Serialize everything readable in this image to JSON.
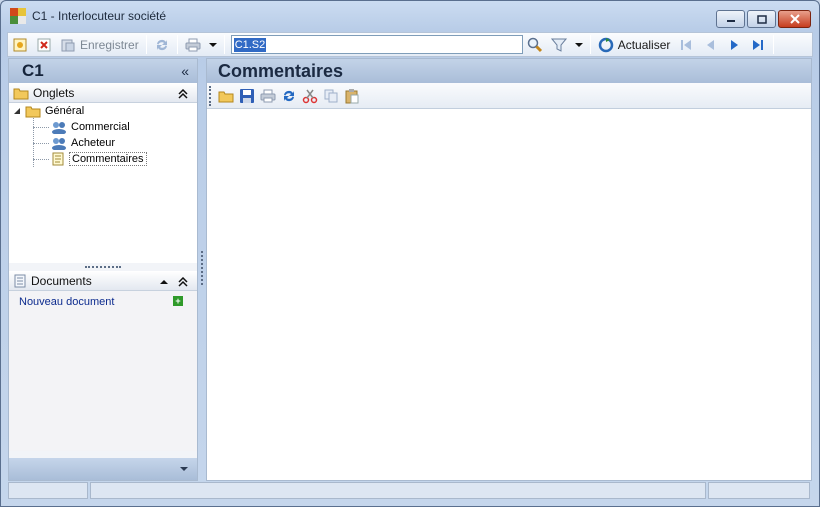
{
  "window": {
    "title": "C1 -  Interlocuteur société"
  },
  "toolbar": {
    "save_label": "Enregistrer",
    "search_value": "C1.S2",
    "refresh_label": "Actualiser"
  },
  "left": {
    "header": "C1",
    "collapse_glyph": "«",
    "tabs_section": "Onglets",
    "tree": {
      "root": "Général",
      "children": [
        "Commercial",
        "Acheteur",
        "Commentaires"
      ]
    },
    "documents_section": "Documents",
    "new_document": "Nouveau document"
  },
  "main": {
    "title": "Commentaires"
  },
  "colors": {
    "accent": "#316ac5",
    "header_gradient_top": "#c3d3e8",
    "link": "#0c2b8e"
  }
}
